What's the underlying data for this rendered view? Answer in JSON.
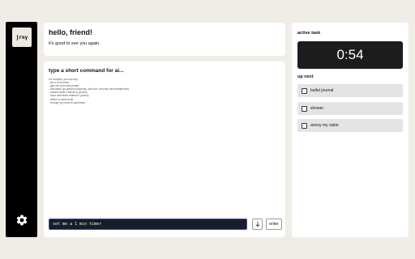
{
  "sidebar": {
    "logo_text": "jrny",
    "settings_icon": "gear-icon"
  },
  "greeting": {
    "title": "hello, friend!",
    "subtitle": "it's good to see you again."
  },
  "command": {
    "title": "type a short command for ai...",
    "examples": [
      "for example, you can say:",
      "- set a 5 min timer",
      "- give me a journal prompt",
      "- add tasks: go grocery shopping, call mom, and buy new headphones",
      "- remove tasks: restock in grocery",
      "- done with tasks related to grocery",
      "- switch to dark mode",
      "- change my name to superman"
    ],
    "input_value": "set me a 1 min timer",
    "mic_icon": "mic-arrow-icon",
    "enter_label": "enter"
  },
  "active_task": {
    "label": "active task",
    "timer": "0:54"
  },
  "up_next": {
    "label": "up next",
    "tasks": [
      {
        "label": "bullet journal",
        "checked": false
      },
      {
        "label": "shower",
        "checked": false
      },
      {
        "label": "annoy my sister",
        "checked": false
      }
    ]
  }
}
